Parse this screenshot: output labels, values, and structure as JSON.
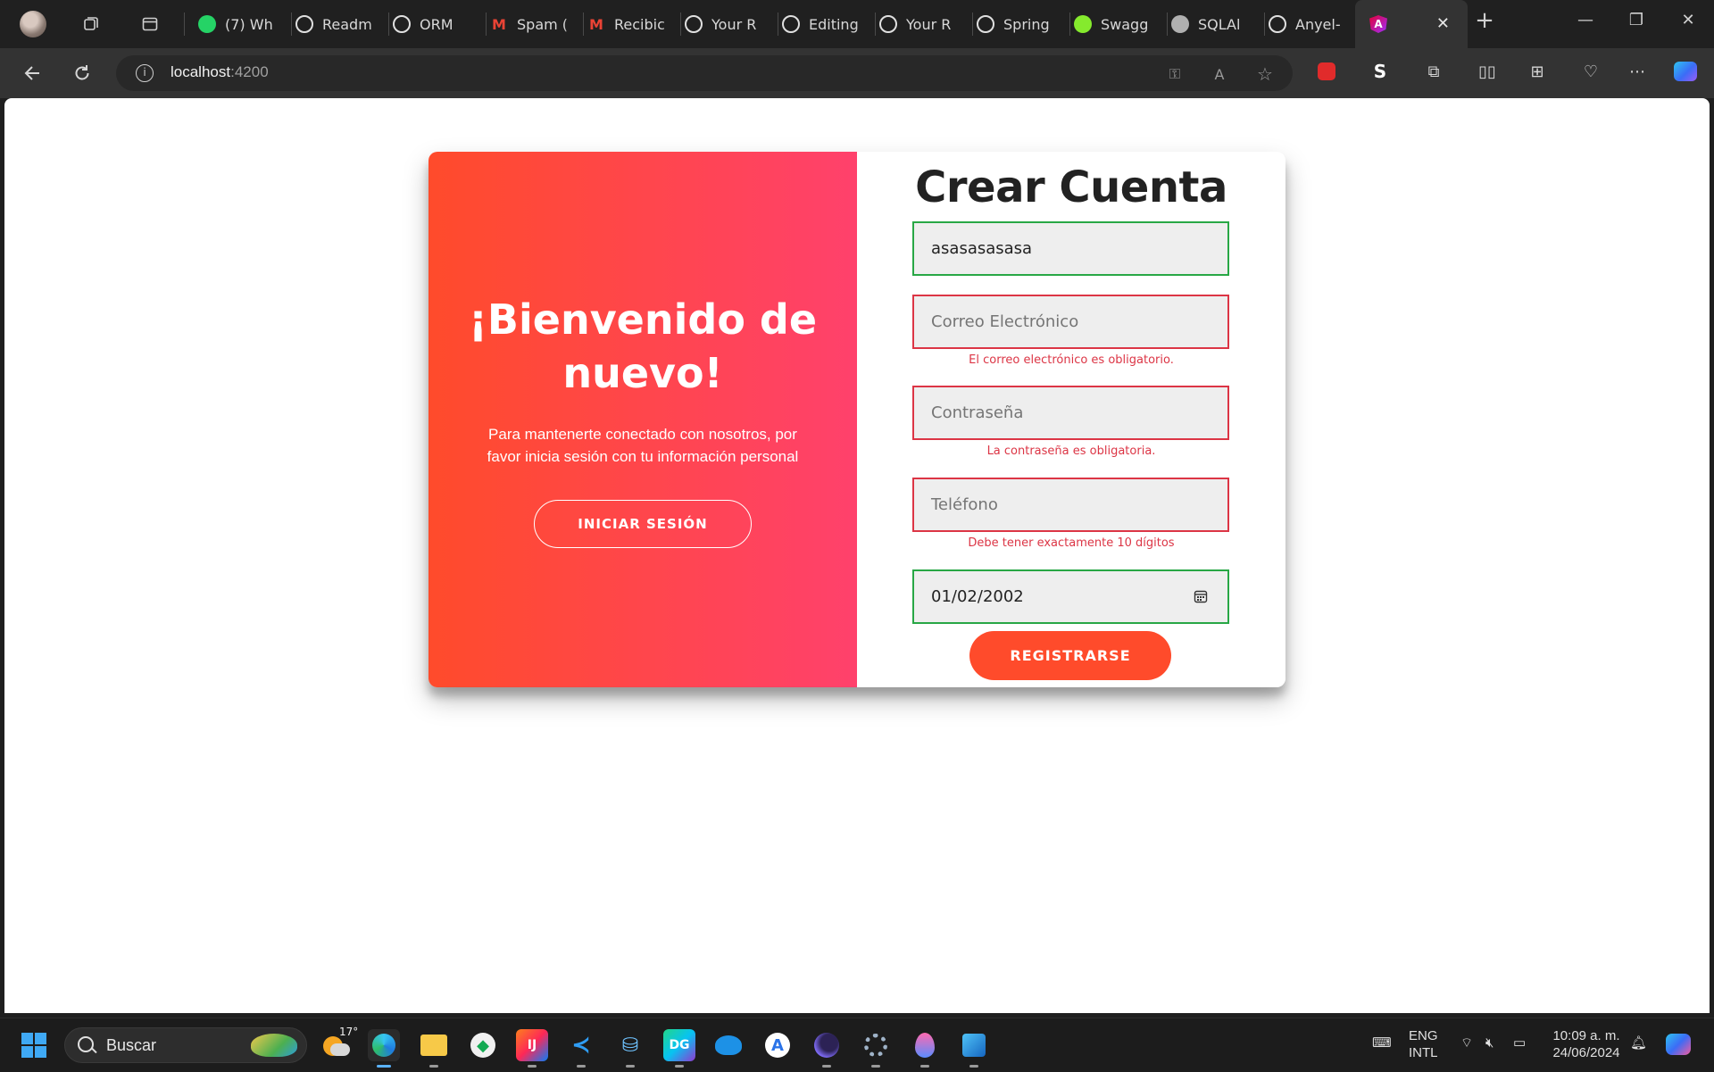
{
  "browser": {
    "tabs": [
      {
        "label": "(7) Wh",
        "favicon": "whatsapp-icon",
        "color": "#25d366"
      },
      {
        "label": "Readm",
        "favicon": "openai-icon",
        "color": "#e0e0e0"
      },
      {
        "label": "ORM",
        "favicon": "document-icon",
        "color": "#e0e0e0"
      },
      {
        "label": "Spam (",
        "favicon": "gmail-icon",
        "color": "#ea4335"
      },
      {
        "label": "Recibic",
        "favicon": "gmail-icon",
        "color": "#ea4335"
      },
      {
        "label": "Your R",
        "favicon": "github-icon",
        "color": "#e0e0e0"
      },
      {
        "label": "Editing",
        "favicon": "github-icon",
        "color": "#e0e0e0"
      },
      {
        "label": "Your R",
        "favicon": "github-icon",
        "color": "#e0e0e0"
      },
      {
        "label": "Spring",
        "favicon": "github-icon",
        "color": "#e0e0e0"
      },
      {
        "label": "Swagg",
        "favicon": "swagger-icon",
        "color": "#85ea2d"
      },
      {
        "label": "SQLAl",
        "favicon": "sqlalchemy-icon",
        "color": "#b0b0b0"
      },
      {
        "label": "Anyel-",
        "favicon": "github-icon",
        "color": "#e0e0e0"
      }
    ],
    "address": {
      "host": "localhost",
      "port": ":4200"
    }
  },
  "overlay": {
    "title_line1": "¡Bienvenido de",
    "title_line2": "nuevo!",
    "paragraph": "Para mantenerte conectado con nosotros, por favor inicia sesión con tu información personal",
    "signin_button": "INICIAR SESIÓN"
  },
  "form": {
    "title": "Crear Cuenta",
    "name_value": "asasasasasa",
    "email_placeholder": "Correo Electrónico",
    "email_error": "El correo electrónico es obligatorio.",
    "password_placeholder": "Contraseña",
    "password_error": "La contraseña es obligatoria.",
    "phone_placeholder": "Teléfono",
    "phone_error": "Debe tener exactamente 10 dígitos",
    "date_value": "01/02/2002",
    "submit_label": "REGISTRARSE"
  },
  "taskbar": {
    "search_placeholder": "Buscar",
    "weather": "17°",
    "lang_line1": "ENG",
    "lang_line2": "INTL",
    "time": "10:09 a. m.",
    "date": "24/06/2024"
  },
  "colors": {
    "gradient_start": "#ff4b2b",
    "gradient_end": "#ff416c",
    "error": "#dc3545",
    "valid": "#28a745"
  }
}
